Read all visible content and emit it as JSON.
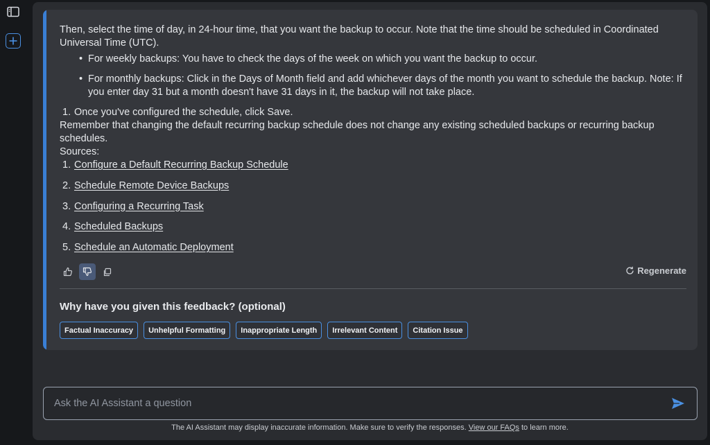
{
  "response": {
    "intro": "Then, select the time of day, in 24-hour time, that you want the backup to occur. Note that the time should be scheduled in Coordinated Universal Time (UTC).",
    "bullets": [
      "For weekly backups: You have to check the days of the week on which you want the backup to occur.",
      "For monthly backups: Click in the Days of Month field and add whichever days of the month you want to schedule the backup. Note: If you enter day 31 but a month doesn't have 31 days in it, the backup will not take place."
    ],
    "step": {
      "number": "1.",
      "text": "Once you've configured the schedule, click Save."
    },
    "note": "Remember that changing the default recurring backup schedule does not change any existing scheduled backups or recurring backup schedules.",
    "sources_label": "Sources:",
    "sources": [
      {
        "number": "1.",
        "title": "Configure a Default Recurring Backup Schedule"
      },
      {
        "number": "2.",
        "title": "Schedule Remote Device Backups"
      },
      {
        "number": "3.",
        "title": "Configuring a Recurring Task"
      },
      {
        "number": "4.",
        "title": "Scheduled Backups"
      },
      {
        "number": "5.",
        "title": "Schedule an Automatic Deployment"
      }
    ]
  },
  "actions": {
    "thumbs_up_icon": "thumbs-up-icon",
    "thumbs_down_icon": "thumbs-down-icon",
    "copy_icon": "copy-icon",
    "regenerate_label": "Regenerate"
  },
  "feedback": {
    "title": "Why have you given this feedback? (optional)",
    "options": [
      "Factual Inaccuracy",
      "Unhelpful Formatting",
      "Inappropriate Length",
      "Irrelevant Content",
      "Citation Issue"
    ]
  },
  "composer": {
    "placeholder": "Ask the AI Assistant a question"
  },
  "disclaimer": {
    "before": "The AI Assistant may display inaccurate information. Make sure to verify the responses. ",
    "link": "View our FAQs",
    "after": " to learn more."
  },
  "colors": {
    "accent": "#3a7fd5",
    "chip_border": "#4a90e2",
    "send": "#4a90e2"
  }
}
